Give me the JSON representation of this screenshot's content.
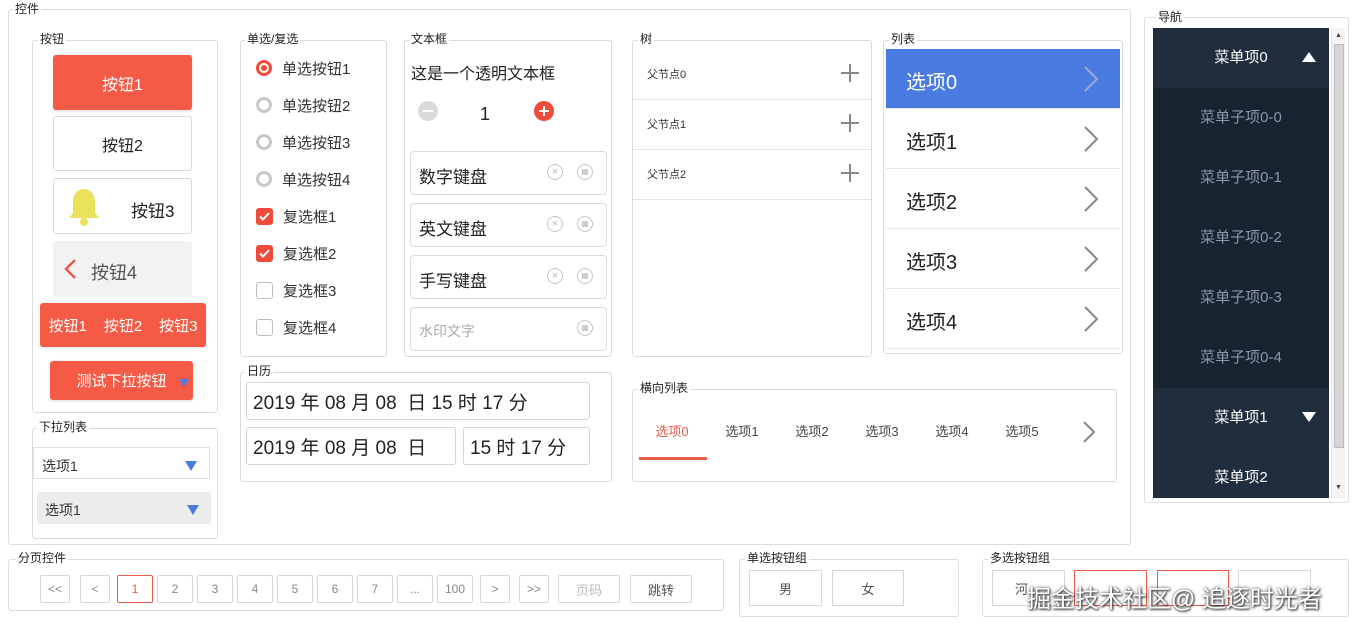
{
  "controls_title": "控件",
  "buttons": {
    "title": "按钮",
    "btn1": "按钮1",
    "btn2": "按钮2",
    "btn3": "按钮3",
    "btn4": "按钮4",
    "group": [
      "按钮1",
      "按钮2",
      "按钮3"
    ],
    "dropdown_btn": "测试下拉按钮"
  },
  "select": {
    "title": "下拉列表",
    "value1": "选项1",
    "value2": "选项1"
  },
  "choice": {
    "title": "单选/复选",
    "radios": [
      {
        "label": "单选按钮1",
        "checked": true
      },
      {
        "label": "单选按钮2",
        "checked": false
      },
      {
        "label": "单选按钮3",
        "checked": false
      },
      {
        "label": "单选按钮4",
        "checked": false
      }
    ],
    "checks": [
      {
        "label": "复选框1",
        "checked": true
      },
      {
        "label": "复选框2",
        "checked": true
      },
      {
        "label": "复选框3",
        "checked": false
      },
      {
        "label": "复选框4",
        "checked": false
      }
    ]
  },
  "calendar": {
    "title": "日历",
    "row1": "2019 年 08 月 08  日 15 时 17 分",
    "row2_date": "2019 年 08 月 08  日",
    "row2_time": "15 时 17 分"
  },
  "textbox": {
    "title": "文本框",
    "transparent": "这是一个透明文本框",
    "stepper_value": "1",
    "numeric": "数字键盘",
    "english": "英文键盘",
    "handwrite": "手写键盘",
    "watermark_placeholder": "水印文字"
  },
  "tree": {
    "title": "树",
    "nodes": [
      "父节点0",
      "父节点1",
      "父节点2"
    ]
  },
  "list": {
    "title": "列表",
    "items": [
      "选项0",
      "选项1",
      "选项2",
      "选项3",
      "选项4"
    ],
    "selected_index": 0
  },
  "hlist": {
    "title": "横向列表",
    "items": [
      "选项0",
      "选项1",
      "选项2",
      "选项3",
      "选项4",
      "选项5"
    ],
    "selected_index": 0
  },
  "nav": {
    "title": "导航",
    "menu0": "菜单项0",
    "subs": [
      "菜单子项0-0",
      "菜单子项0-1",
      "菜单子项0-2",
      "菜单子项0-3",
      "菜单子项0-4"
    ],
    "menu1": "菜单项1",
    "menu2": "菜单项2"
  },
  "pagination": {
    "title": "分页控件",
    "first": "<<",
    "prev": "<",
    "pages": [
      "1",
      "2",
      "3",
      "4",
      "5",
      "6",
      "7",
      "...",
      "100"
    ],
    "current": "1",
    "next": ">",
    "last": ">>",
    "page_placeholder": "页码",
    "jump": "跳转"
  },
  "radio_group": {
    "title": "单选按钮组",
    "options": [
      "男",
      "女"
    ]
  },
  "multi_group": {
    "title": "多选按钮组",
    "first_visible": "河"
  },
  "watermark": "掘金技术社区@ 追逐时光者",
  "colors": {
    "accent_red": "#f55a46",
    "list_selected": "#4a7be0",
    "nav_bg": "#1f2d3d"
  }
}
